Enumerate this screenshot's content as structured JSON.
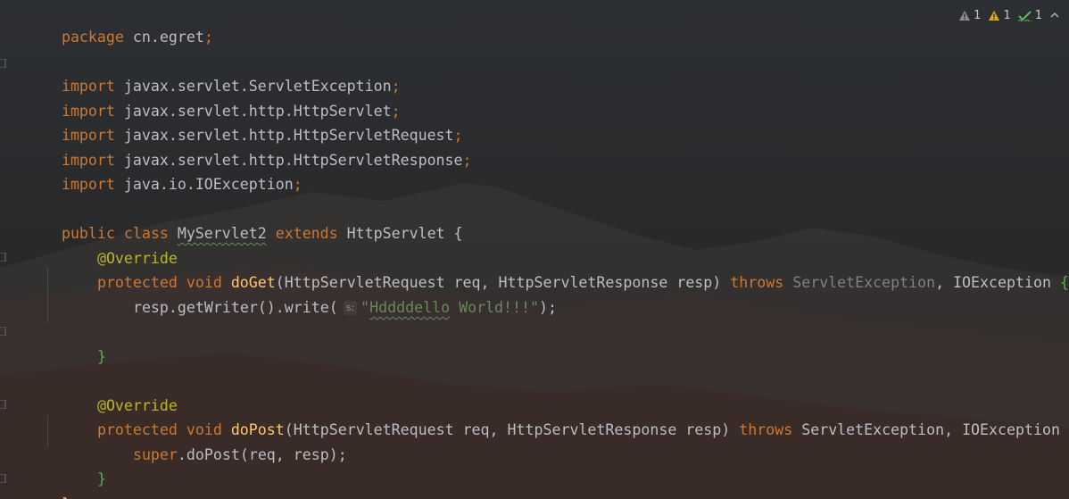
{
  "editor": {
    "lines": {
      "l1": {
        "kw": "package",
        "rest": " cn.egret",
        "semi": ";"
      },
      "l3": {
        "kw": "import",
        "rest": " javax.servlet.ServletException",
        "semi": ";"
      },
      "l4": {
        "kw": "import",
        "rest": " javax.servlet.http.HttpServlet",
        "semi": ";"
      },
      "l5": {
        "kw": "import",
        "rest": " javax.servlet.http.HttpServletRequest",
        "semi": ";"
      },
      "l6": {
        "kw": "import",
        "rest": " javax.servlet.http.HttpServletResponse",
        "semi": ";"
      },
      "l7": {
        "kw": "import",
        "rest": " java.io.IOException",
        "semi": ";"
      },
      "l9": {
        "kw1": "public class ",
        "cls": "MyServlet2",
        "kw2": " extends ",
        "sup": "HttpServlet",
        "brace": " {"
      },
      "l10": {
        "ann": "@Override"
      },
      "l11": {
        "kw": "protected void ",
        "fn": "doGet",
        "p1": "(HttpServletRequest req, HttpServletResponse resp) ",
        "throws": "throws ",
        "ex1": "ServletException",
        "comma": ", ",
        "ex2": "IOException",
        "brace": " {"
      },
      "l12": {
        "pre": "resp.getWriter().write(",
        "hint": "s:",
        "q1": "\"",
        "strsq": "Hddddello",
        "strrest": " World!!!\"",
        "post": ");"
      },
      "l14": {
        "brace": "}"
      },
      "l16": {
        "ann": "@Override"
      },
      "l17": {
        "kw": "protected void ",
        "fn": "doPost",
        "p1": "(HttpServletRequest req, HttpServletResponse resp) ",
        "throws": "throws ",
        "ex1": "ServletException",
        "comma": ", ",
        "ex2": "IOException",
        "brace": " {"
      },
      "l18": {
        "sup": "super",
        "rest": ".doPost(req, resp);"
      },
      "l19": {
        "brace": "}"
      },
      "l20": {
        "brace": "}"
      }
    }
  },
  "inspections": {
    "warnings_1": {
      "icon": "warning-triangle-icon",
      "count": "1",
      "color": "#8c8c8c"
    },
    "warnings_2": {
      "icon": "weak-warning-triangle-icon",
      "count": "1",
      "color": "#e0a81e"
    },
    "typos": {
      "icon": "typo-check-icon",
      "count": "1",
      "color": "#5fb85f"
    },
    "expand": {
      "icon": "chevron-up-icon"
    }
  },
  "colors": {
    "keyword": "#cc7832",
    "annotation": "#bbb529",
    "method": "#ffc66d",
    "string": "#6a8759",
    "text": "#bcbec4",
    "muted": "#808080"
  }
}
